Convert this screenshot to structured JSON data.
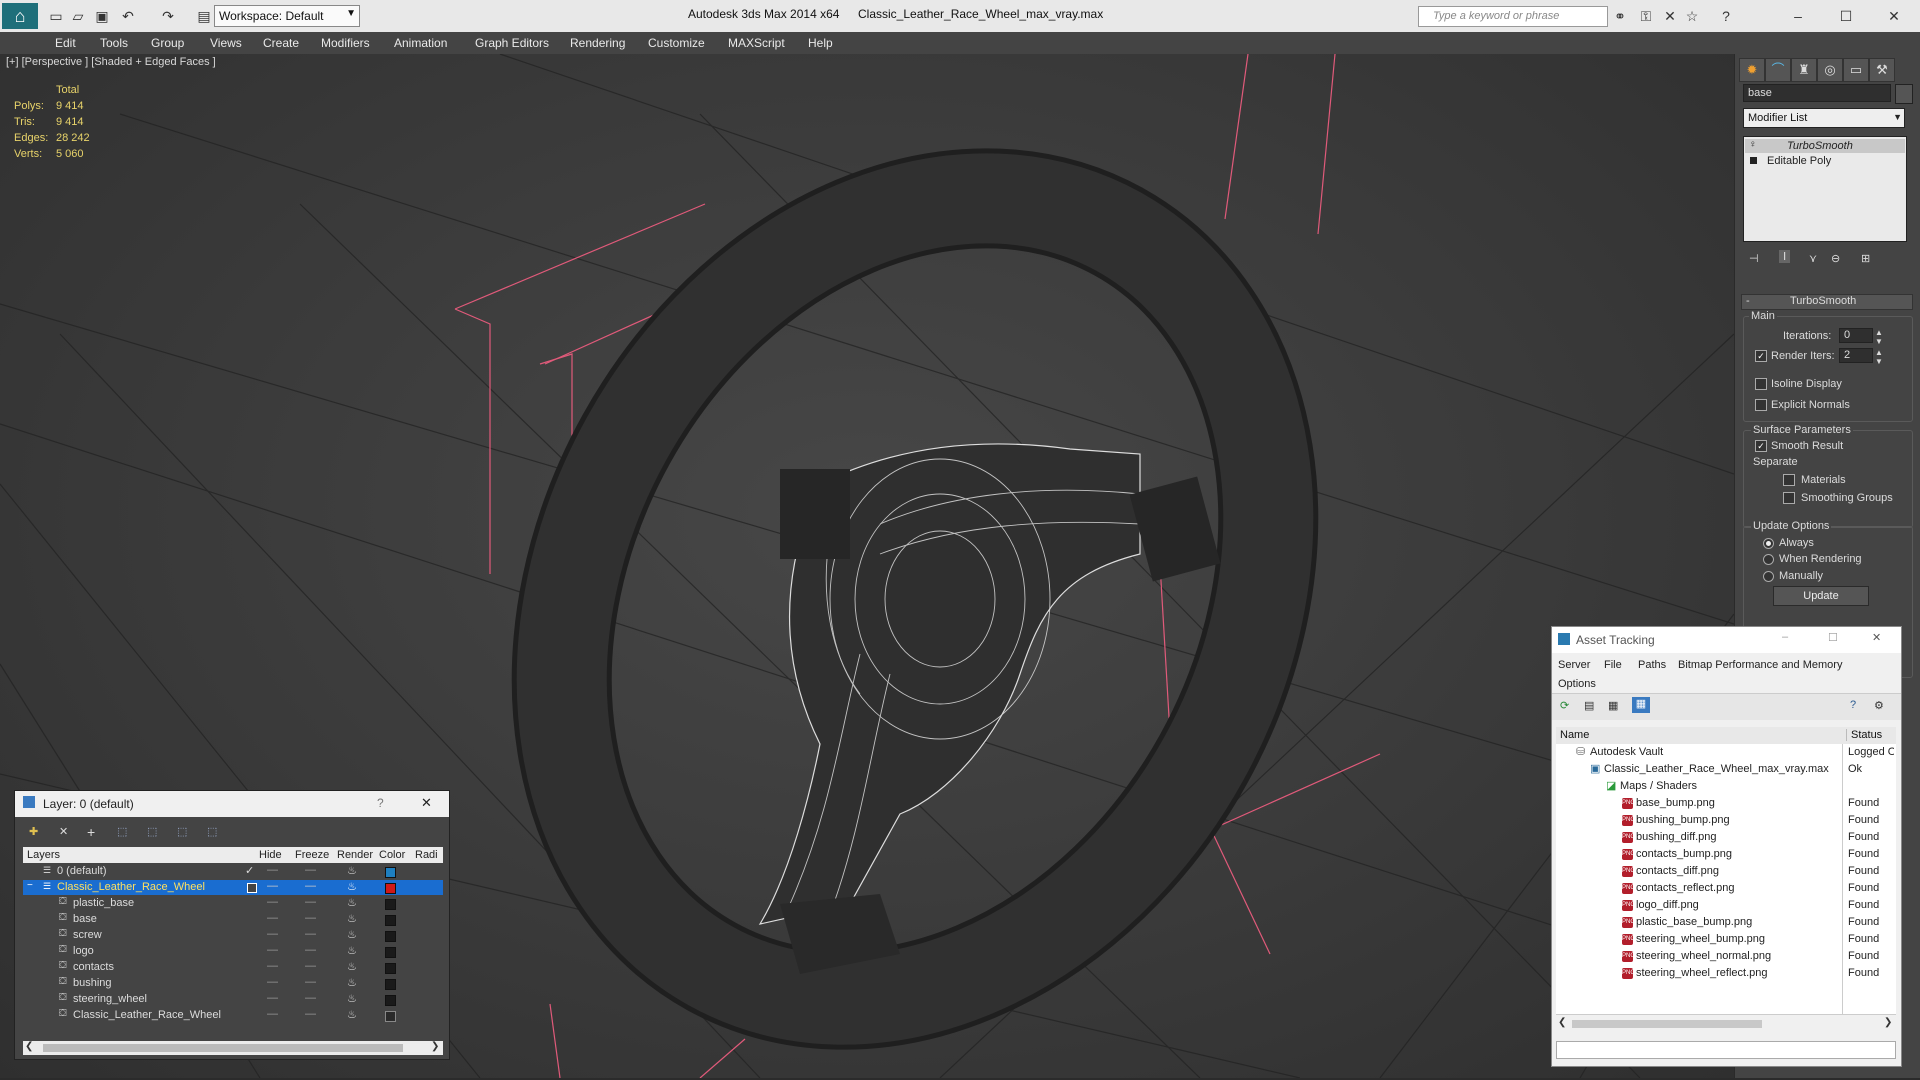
{
  "titlebar": {
    "app_title": "Autodesk 3ds Max  2014 x64",
    "file_title": "Classic_Leather_Race_Wheel_max_vray.max",
    "workspace": "Workspace: Default",
    "search_placeholder": "Type a keyword or phrase"
  },
  "menu": [
    "Edit",
    "Tools",
    "Group",
    "Views",
    "Create",
    "Modifiers",
    "Animation",
    "Graph Editors",
    "Rendering",
    "Customize",
    "MAXScript",
    "Help"
  ],
  "viewport": {
    "label": "[+] [Perspective ] [Shaded + Edged Faces ]",
    "stats_header": "Total",
    "stats": [
      {
        "label": "Polys:",
        "value": "9 414"
      },
      {
        "label": "Tris:",
        "value": "9 414"
      },
      {
        "label": "Edges:",
        "value": "28 242"
      },
      {
        "label": "Verts:",
        "value": "5 060"
      }
    ]
  },
  "command_panel": {
    "object_name": "base",
    "modifier_list": "Modifier List",
    "stack": [
      "TurboSmooth",
      "Editable Poly"
    ],
    "rollout_title": "TurboSmooth",
    "main_label": "Main",
    "iterations_label": "Iterations:",
    "iterations_value": "0",
    "render_iters_label": "Render Iters:",
    "render_iters_value": "2",
    "isoline": "Isoline Display",
    "explicit_normals": "Explicit Normals",
    "surface_params": "Surface Parameters",
    "smooth_result": "Smooth Result",
    "separate": "Separate",
    "materials": "Materials",
    "smoothing_groups": "Smoothing Groups",
    "update_options": "Update Options",
    "always": "Always",
    "when_rendering": "When Rendering",
    "manually": "Manually",
    "update_button": "Update"
  },
  "layer_dialog": {
    "title": "Layer: 0 (default)",
    "help": "?",
    "columns": [
      "Layers",
      "Hide",
      "Freeze",
      "Render",
      "Color",
      "Radi"
    ],
    "rows": [
      {
        "name": "0 (default)",
        "color": "#1e7fc0"
      },
      {
        "name": "Classic_Leather_Race_Wheel",
        "color": "#d01818"
      },
      {
        "name": "plastic_base",
        "color": "#1a1a1a"
      },
      {
        "name": "base",
        "color": "#1a1a1a"
      },
      {
        "name": "screw",
        "color": "#1a1a1a"
      },
      {
        "name": "logo",
        "color": "#1a1a1a"
      },
      {
        "name": "contacts",
        "color": "#1a1a1a"
      },
      {
        "name": "bushing",
        "color": "#1a1a1a"
      },
      {
        "name": "steering_wheel",
        "color": "#1a1a1a"
      },
      {
        "name": "Classic_Leather_Race_Wheel",
        "color": "#2a2a2a"
      }
    ]
  },
  "asset_tracking": {
    "title": "Asset Tracking",
    "menu": [
      "Server",
      "File",
      "Paths",
      "Bitmap Performance and Memory"
    ],
    "menu2": "Options",
    "col_name": "Name",
    "col_status": "Status",
    "vault": {
      "name": "Autodesk Vault",
      "status": "Logged O"
    },
    "file": {
      "name": "Classic_Leather_Race_Wheel_max_vray.max",
      "status": "Ok"
    },
    "maps": "Maps / Shaders",
    "png_badge": "PNG",
    "files": [
      {
        "name": "base_bump.png",
        "status": "Found"
      },
      {
        "name": "bushing_bump.png",
        "status": "Found"
      },
      {
        "name": "bushing_diff.png",
        "status": "Found"
      },
      {
        "name": "contacts_bump.png",
        "status": "Found"
      },
      {
        "name": "contacts_diff.png",
        "status": "Found"
      },
      {
        "name": "contacts_reflect.png",
        "status": "Found"
      },
      {
        "name": "logo_diff.png",
        "status": "Found"
      },
      {
        "name": "plastic_base_bump.png",
        "status": "Found"
      },
      {
        "name": "steering_wheel_bump.png",
        "status": "Found"
      },
      {
        "name": "steering_wheel_normal.png",
        "status": "Found"
      },
      {
        "name": "steering_wheel_reflect.png",
        "status": "Found"
      }
    ]
  }
}
